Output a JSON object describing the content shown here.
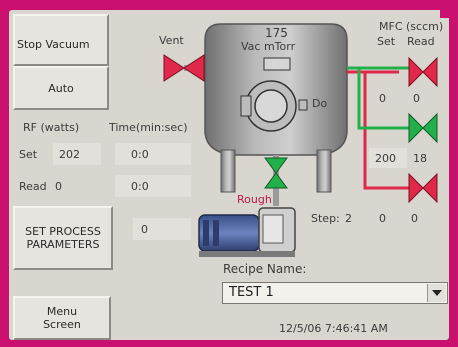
{
  "buttons": {
    "stop_vacuum": "Stop Vacuum",
    "auto": "Auto",
    "set_process_parameters_line1": "SET PROCESS",
    "set_process_parameters_line2": "PARAMETERS",
    "menu_screen_line1": "Menu",
    "menu_screen_line2": "Screen"
  },
  "rf": {
    "header_rf": "RF (watts)",
    "header_time": "Time(min:sec)",
    "set_label": "Set",
    "set_watts": "202",
    "set_time": "0:0",
    "read_label": "Read",
    "read_watts": "0",
    "read_time": "0:0",
    "process_value": "0"
  },
  "chamber": {
    "vent_label": "Vent",
    "pressure_value": "175",
    "pressure_units": "Vac mTorr",
    "do_label": "Do",
    "rough_label": "Rough"
  },
  "mfc": {
    "header_line1": "MFC (sccm)",
    "header_set": "Set",
    "header_read": "Read",
    "row1_set": "0",
    "row1_read": "0",
    "row2_set": "200",
    "row2_read": "18"
  },
  "step": {
    "label": "Step:",
    "number": "2",
    "value1": "0",
    "value2": "0"
  },
  "recipe": {
    "label": "Recipe Name:",
    "selected": "TEST 1"
  },
  "timestamp": "12/5/06 7:46:41 AM",
  "colors": {
    "bezel": "#c9106e",
    "valve_closed": "#e0284a",
    "valve_open": "#22b04a",
    "pipe_red": "#e0284a",
    "pipe_green": "#22b04a"
  }
}
